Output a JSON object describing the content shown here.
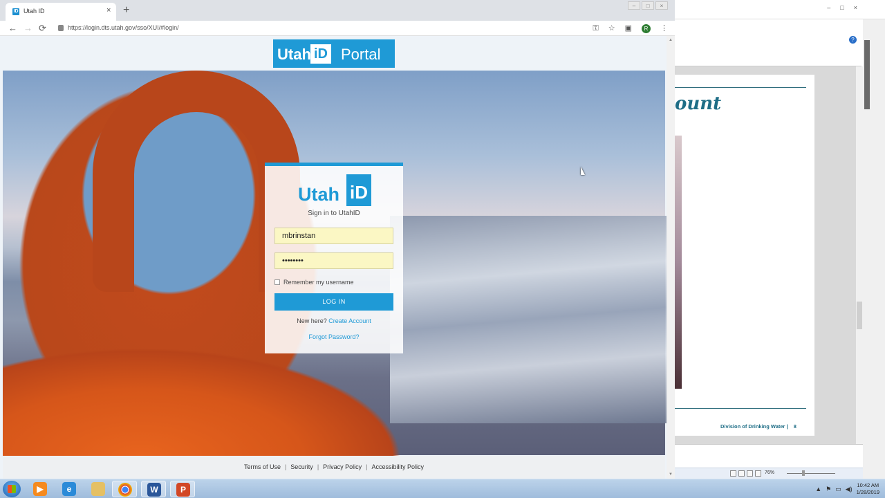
{
  "browser": {
    "tab_title": "Utah ID",
    "tab_favicon": "ID",
    "tab_close": "×",
    "new_tab": "+",
    "url": "https://login.dts.utah.gov/sso/XUI/#login/",
    "nav": {
      "back": "←",
      "forward": "→",
      "reload": "⟳"
    },
    "toolbar_icons": [
      "key-icon",
      "star-icon",
      "extension-icon",
      "profile-icon",
      "menu-icon"
    ],
    "profile_initial": "R",
    "window_controls": [
      "–",
      "□",
      "×"
    ]
  },
  "banner": {
    "utah": "Utah",
    "id": "iD",
    "portal": "Portal"
  },
  "login": {
    "logo_utah": "Utah",
    "logo_id": "iD",
    "signin_label": "Sign in to UtahID",
    "username_value": "mbrinstan",
    "password_mask": "••••••••",
    "remember_label": "Remember my username",
    "login_button": "LOG IN",
    "new_here": "New here?",
    "create_account": "Create Account",
    "forgot_password": "Forgot Password?"
  },
  "footer": {
    "links": [
      "Terms of Use",
      "Security",
      "Privacy Policy",
      "Accessibility Policy"
    ],
    "separator": "|"
  },
  "word_doc": {
    "heading_fragment": "ount",
    "footer_text": "Division of Drinking Water",
    "footer_separator": "|",
    "page_number": "8",
    "zoom": "76%",
    "window_controls": [
      "–",
      "□",
      "×"
    ],
    "help": "?"
  },
  "taskbar": {
    "apps": [
      "start-button",
      "media-player-icon",
      "internet-explorer-icon",
      "file-explorer-icon",
      "chrome-icon",
      "word-icon",
      "powerpoint-icon"
    ],
    "time": "10:42 AM",
    "date": "1/28/2019"
  },
  "colors": {
    "accent": "#1f9ad6",
    "field_bg": "#fbf7c4",
    "doc_heading": "#1e6d86"
  }
}
